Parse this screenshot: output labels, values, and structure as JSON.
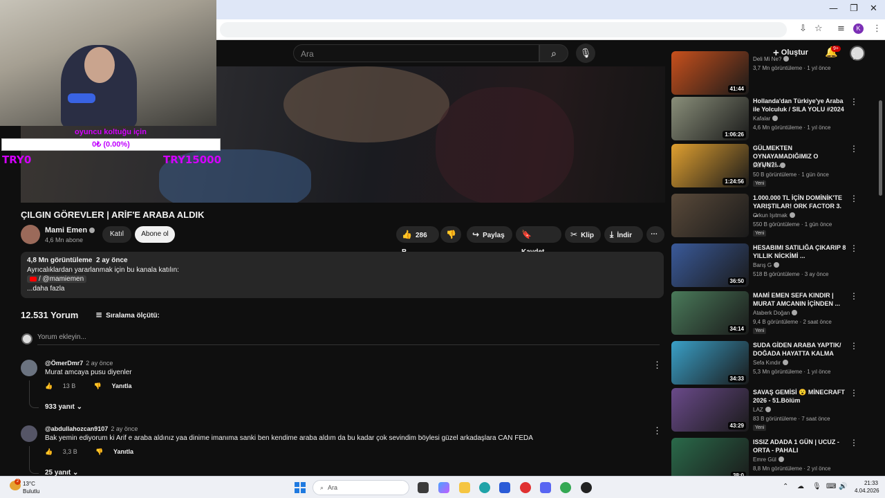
{
  "browser": {
    "minimize": "—",
    "restore": "❐",
    "close": "✕",
    "profile_initial": "K"
  },
  "header": {
    "search_placeholder": "Ara",
    "create_label": "Oluştur",
    "notif_badge": "9+"
  },
  "stream_overlay": {
    "goal_title": "oyuncu koltuğu için",
    "goal_progress": "0₺ (0.00%)",
    "goal_fraction": 0.0,
    "goal_min": "TRY0",
    "goal_max": "TRY15000"
  },
  "video": {
    "title": "ÇILGIN GÖREVLER | ARİF'E ARABA ALDIK",
    "channel": "Mami Emen",
    "subscribers": "4,6 Mn abone",
    "join_label": "Katıl",
    "subscribe_label": "Abone ol",
    "likes": "286 B",
    "share_label": "Paylaş",
    "save_label": "Kaydet",
    "clip_label": "Klip",
    "download_label": "İndir"
  },
  "description": {
    "views": "4,8 Mn görüntüleme",
    "date": "2 ay önce",
    "line1": "Ayrıcalıklardan yararlanmak için bu kanala katılın:",
    "link": "/ @mamiemen",
    "more": "...daha fazla"
  },
  "comments": {
    "count": "12.531 Yorum",
    "sort_label": "Sıralama ölçütü:",
    "add_placeholder": "Yorum ekleyin...",
    "items": [
      {
        "author": "@ÖmerDmr7",
        "time": "2 ay önce",
        "text": "Murat amcaya pusu diyenler",
        "likes": "13 B",
        "reply_label": "Yanıtla",
        "replies": "933 yanıt"
      },
      {
        "author": "@abdullahozcan9107",
        "time": "2 ay önce",
        "text": "Bak yemin ediyorum ki Arif e araba aldınız yaa dinime imanıma sanki ben kendime araba aldım da bu kadar çok sevindim böylesi güzel arkadaşlara CAN FEDA",
        "likes": "3,3 B",
        "reply_label": "Yanıtla",
        "replies": "25 yanıt"
      }
    ]
  },
  "sidebar": {
    "items": [
      {
        "title": "",
        "channel": "Deli Mi Ne?",
        "meta": "3,7 Mn görüntüleme · 1 yıl önce",
        "duration": "41:44",
        "is_new": "",
        "color": "#c8501c"
      },
      {
        "title": "Hollanda'dan Türkiye'ye Araba ile Yolculuk / SILA YOLU #2024",
        "channel": "Kafalar",
        "meta": "4,6 Mn görüntüleme · 1 yıl önce",
        "duration": "1:06:26",
        "is_new": "",
        "color": "#8a8f7a"
      },
      {
        "title": "GÜLMEKTEN OYNAYAMADIĞIMIZ O OYUN?!...",
        "channel": "Barış Can",
        "meta": "50 B görüntüleme · 1 gün önce",
        "duration": "1:24:56",
        "is_new": "Yeni",
        "color": "#e0a030"
      },
      {
        "title": "1.000.000 TL İÇİN DOMİNİK'TE YARIŞTILAR! ORK FACTOR 3. ...",
        "channel": "Orkun Işıtmak",
        "meta": "550 B görüntüleme · 1 gün önce",
        "duration": "",
        "is_new": "Yeni",
        "color": "#5a4a3a"
      },
      {
        "title": "HESABIMI SATILIĞA ÇIKARIP 8 YILLIK NİCKİMİ ...",
        "channel": "Barış G",
        "meta": "518 B görüntüleme · 3 ay önce",
        "duration": "36:50",
        "is_new": "",
        "color": "#3a5a9a"
      },
      {
        "title": "MAMİ EMEN SEFA KINDIR | MURAT AMCANIN İÇİNDEN ...",
        "channel": "Ataberk Doğan",
        "meta": "9,4 B görüntüleme · 2 saat önce",
        "duration": "34:14",
        "is_new": "Yeni",
        "color": "#4a7a5a"
      },
      {
        "title": "SUDA GİDEN ARABA YAPTIK/ DOĞADA HAYATTA KALMA",
        "channel": "Sefa Kındır",
        "meta": "5,3 Mn görüntüleme · 1 yıl önce",
        "duration": "34:33",
        "is_new": "",
        "color": "#3aa0c8"
      },
      {
        "title": "SAVAŞ GEMİSİ 😮 MİNECRAFT 2026 - 51.Bölüm",
        "channel": "LAZ",
        "meta": "83 B görüntüleme · 7 saat önce",
        "duration": "43:29",
        "is_new": "Yeni",
        "color": "#6a4a8a"
      },
      {
        "title": "ISSIZ ADADA 1 GÜN | UCUZ - ORTA - PAHALI",
        "channel": "Emre Gül",
        "meta": "8,8 Mn görüntüleme · 2 yıl önce",
        "duration": "38:0",
        "is_new": "",
        "color": "#2a6a4a"
      }
    ]
  },
  "taskbar": {
    "temp": "13°C",
    "weather": "Bulutlu",
    "weather_badge": "2",
    "search_label": "Ara",
    "time": "21:33",
    "date": "4.04.2026"
  }
}
